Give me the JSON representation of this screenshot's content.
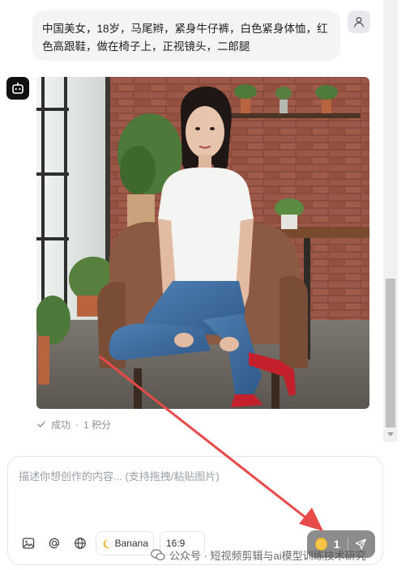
{
  "chat": {
    "user_message": "中国美女，18岁，马尾辫，紧身牛仔裤，白色紧身体恤，红色高跟鞋，做在椅子上，正视镜头，二郎腿",
    "status_text": "成功",
    "status_separator": "·",
    "status_credits": "1 积分"
  },
  "composer": {
    "placeholder": "描述你想创作的内容... (支持拖拽/粘贴图片)",
    "model_label": "Banana",
    "ratio_label": "16:9",
    "credit_count": "1"
  },
  "watermark": {
    "text": "公众号 · 短视频剪辑与ai模型训练技术研究"
  },
  "icons": {
    "user_avatar": "user-icon",
    "bot_avatar": "bot-icon",
    "status": "check-icon",
    "image_upload": "image-icon",
    "mention": "at-icon",
    "web": "globe-icon",
    "model": "moon-icon",
    "coin": "coin-icon",
    "send": "send-icon",
    "watermark": "wechat-icon"
  },
  "colors": {
    "user_bubble": "#f3f4f6",
    "send_button": "#8c8c8c",
    "annotation_arrow": "#e84a4a",
    "coin": "#f6c54a"
  }
}
